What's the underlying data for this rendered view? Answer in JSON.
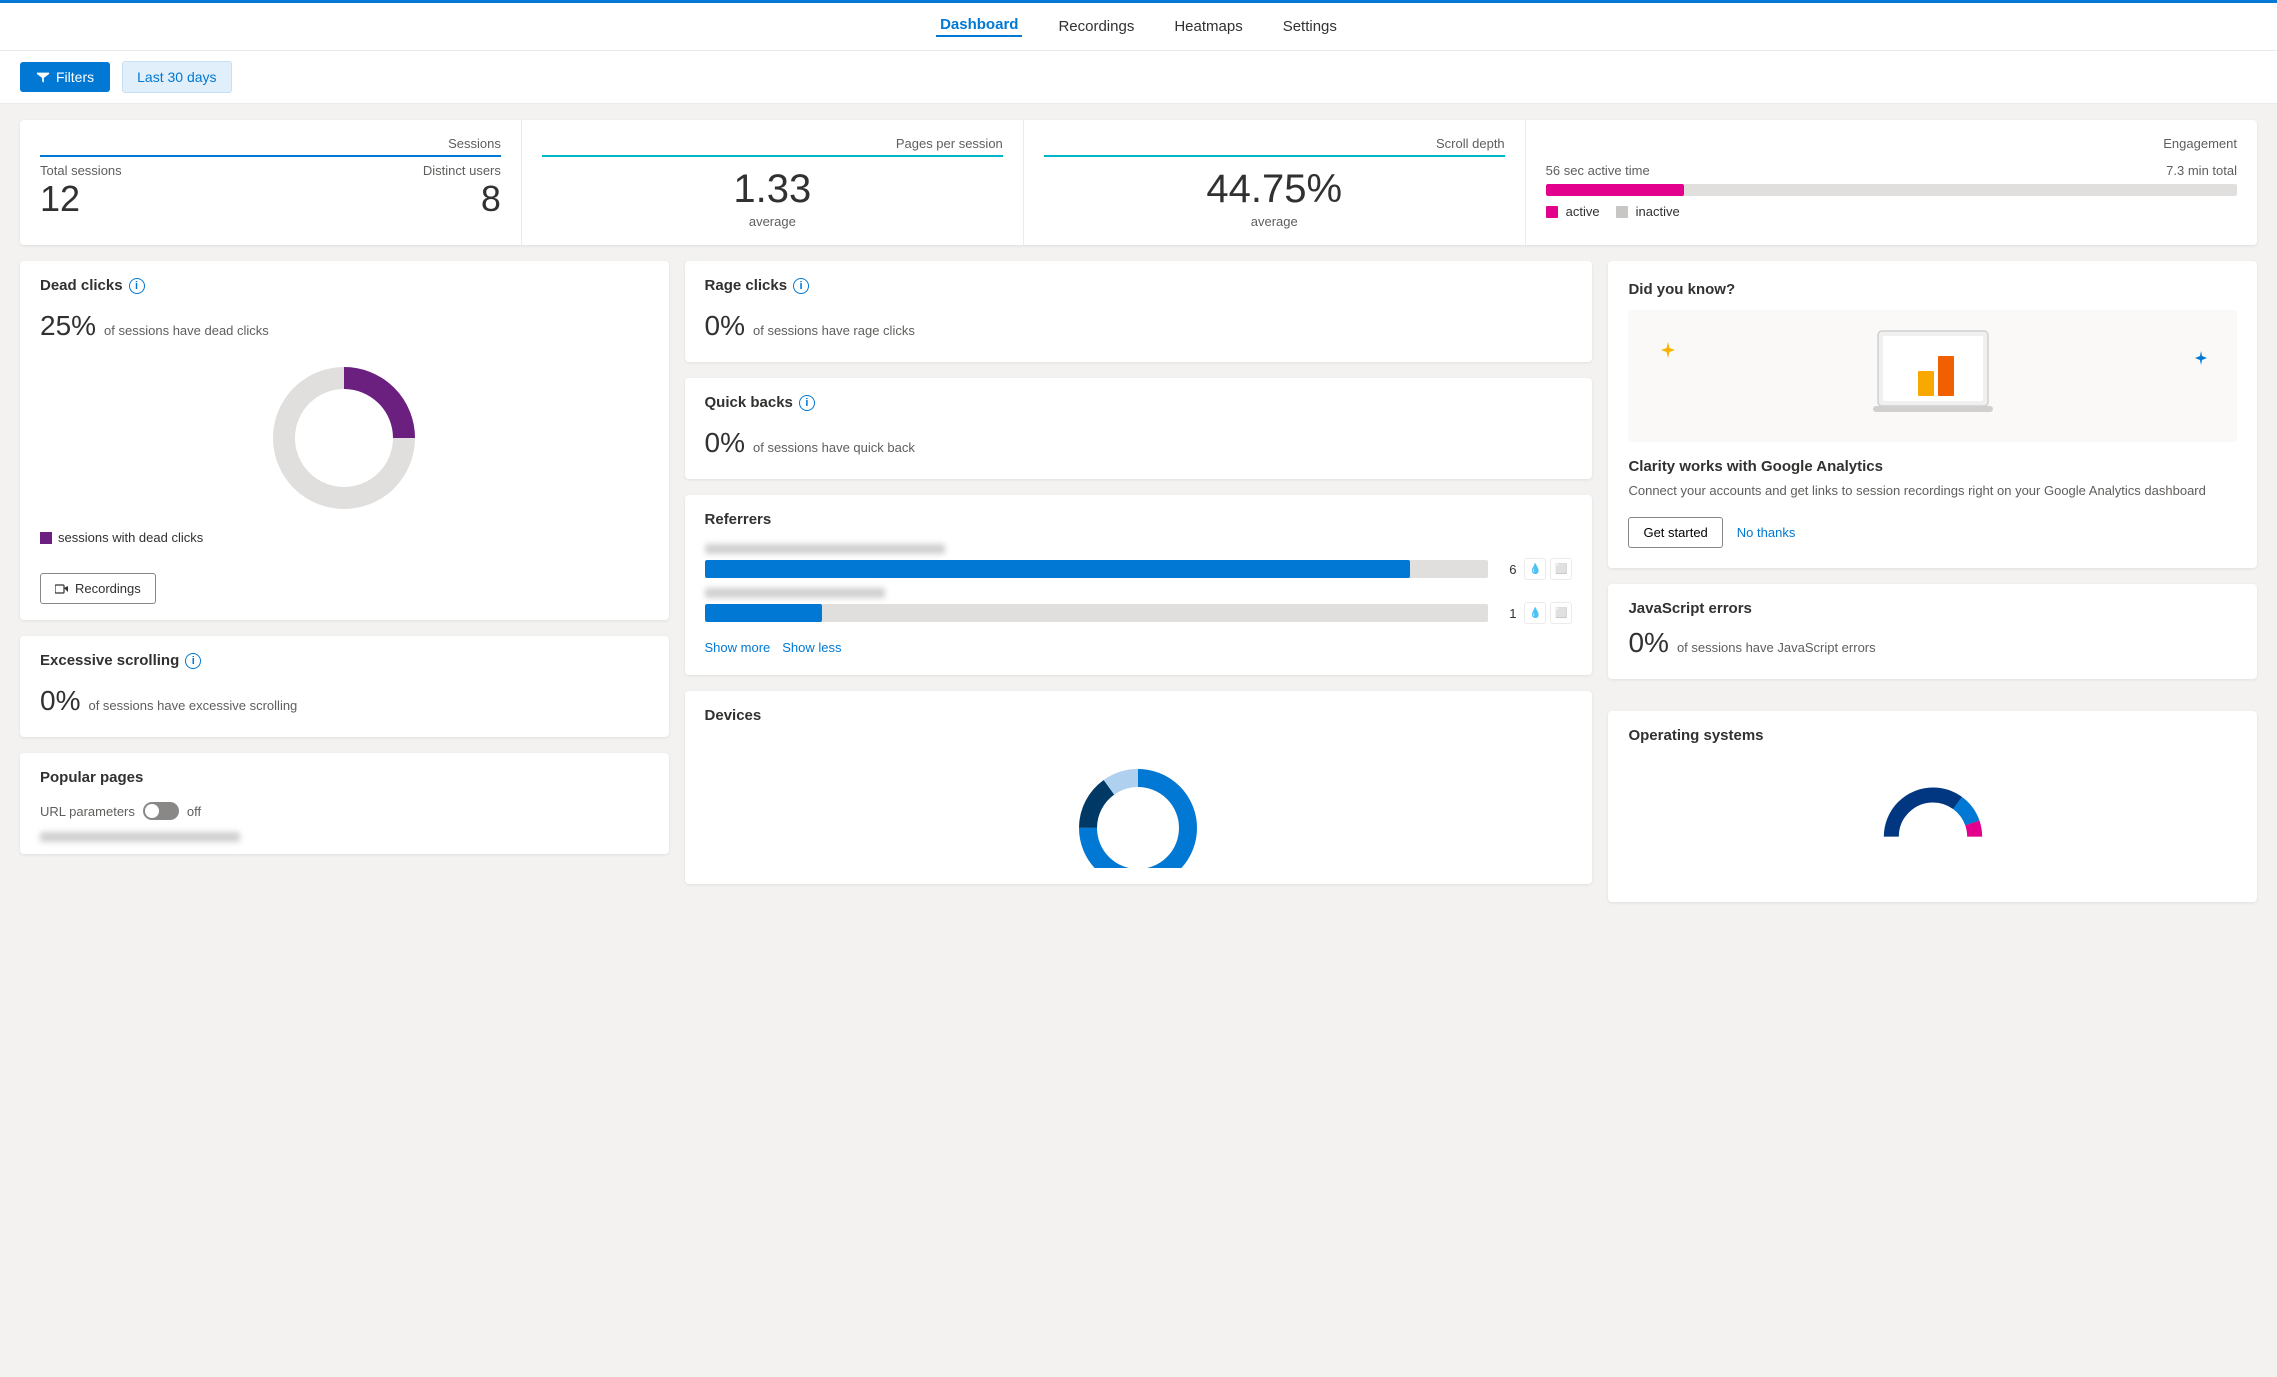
{
  "nav": {
    "links": [
      "Dashboard",
      "Recordings",
      "Heatmaps",
      "Settings"
    ],
    "active": "Dashboard"
  },
  "toolbar": {
    "filters_label": "Filters",
    "date_range_label": "Last 30 days"
  },
  "stats": {
    "sessions": {
      "title": "Sessions",
      "total_label": "Total sessions",
      "total_value": "12",
      "distinct_label": "Distinct users",
      "distinct_value": "8"
    },
    "pages_per_session": {
      "title": "Pages per session",
      "value": "1.33",
      "sub": "average"
    },
    "scroll_depth": {
      "title": "Scroll depth",
      "value": "44.75%",
      "sub": "average"
    },
    "engagement": {
      "title": "Engagement",
      "active_time": "56 sec active time",
      "total_time": "7.3 min total",
      "active_label": "active",
      "inactive_label": "inactive",
      "active_color": "#e3008c",
      "inactive_color": "#c8c6c4"
    }
  },
  "dead_clicks": {
    "title": "Dead clicks",
    "pct": "25%",
    "desc": "of sessions have dead clicks",
    "legend": "sessions with dead clicks",
    "donut_pct": 25,
    "donut_color": "#6b2080",
    "recordings_label": "Recordings"
  },
  "rage_clicks": {
    "title": "Rage clicks",
    "pct": "0%",
    "desc": "of sessions have rage clicks"
  },
  "quick_backs": {
    "title": "Quick backs",
    "pct": "0%",
    "desc": "of sessions have quick back"
  },
  "referrers": {
    "title": "Referrers",
    "items": [
      {
        "count": 6,
        "bar_pct": 90
      },
      {
        "count": 1,
        "bar_pct": 15
      }
    ],
    "show_more": "Show more",
    "show_less": "Show less"
  },
  "devices": {
    "title": "Devices"
  },
  "excessive_scrolling": {
    "title": "Excessive scrolling",
    "pct": "0%",
    "desc": "of sessions have excessive scrolling"
  },
  "popular_pages": {
    "title": "Popular pages",
    "url_params_label": "URL parameters",
    "toggle_state": "off"
  },
  "did_you_know": {
    "title": "Did you know?",
    "feature_title": "Clarity works with Google Analytics",
    "feature_desc": "Connect your accounts and get links to session recordings right on your Google Analytics dashboard",
    "btn_get_started": "Get started",
    "btn_no_thanks": "No thanks"
  },
  "js_errors": {
    "title": "JavaScript errors",
    "pct": "0%",
    "desc": "of sessions have JavaScript errors"
  },
  "os": {
    "title": "Operating systems"
  }
}
